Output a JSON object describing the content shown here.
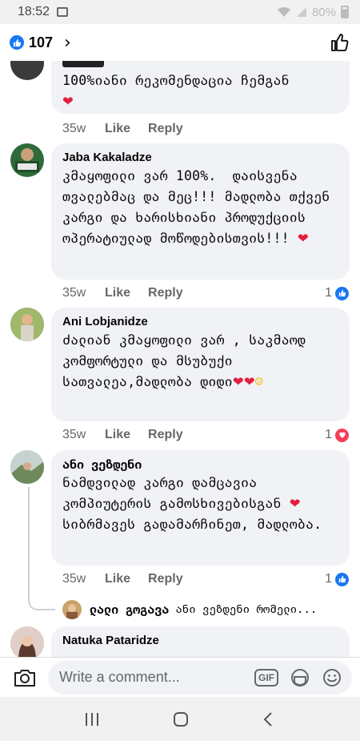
{
  "status_bar": {
    "time": "18:52",
    "battery": "80%"
  },
  "header": {
    "reaction_count": "107"
  },
  "comments": [
    {
      "name": "",
      "text": "100%იანი რეკომენდაცია ჩემგან",
      "time": "35w",
      "like_label": "Like",
      "reply_label": "Reply",
      "reaction_count": ""
    },
    {
      "name": "Jaba Kakaladze",
      "text": "კმაყოფილი ვარ 100%.  დაისვენა თვალებმაც და მეც!!! მადლობა თქვენ კარგი და ხარისხიანი პროდუქციის ოპერატიულად მოწოდებისთვის!!! ",
      "time": "35w",
      "like_label": "Like",
      "reply_label": "Reply",
      "reaction_count": "1"
    },
    {
      "name": "Ani Lobjanidze",
      "text": "ძალიან კმაყოფილი ვარ , საკმაოდ კომფორტული და მსუბუქი სათვალეა,მადლობა დიდი",
      "time": "35w",
      "like_label": "Like",
      "reply_label": "Reply",
      "reaction_count": "1"
    },
    {
      "name": "ანი ვეზდენი",
      "text_before_heart": "ნამდვილად კარგი დამცავია კომპიუტერის გამოსხივებისგან ",
      "text_after_heart": " სიბრმავეს გადამარჩინეთ, მადლობა.",
      "time": "35w",
      "like_label": "Like",
      "reply_label": "Reply",
      "reaction_count": "1"
    },
    {
      "name": "Natuka Pataridze"
    }
  ],
  "reply_preview": {
    "name": "ლალი გოგავა",
    "text": "ანი ვეზდენი რომელი..."
  },
  "composer": {
    "placeholder": "Write a comment...",
    "gif_label": "GIF"
  },
  "colors": {
    "facebook_blue": "#1877f2",
    "heart_red": "#e41e3f",
    "bubble_gray": "#f0f2f5",
    "meta_gray": "#65676b"
  },
  "icons": [
    "image-icon",
    "wifi-icon",
    "signal-icon",
    "battery-icon",
    "like-icon",
    "chevron-right-icon",
    "thumbs-up-outline-icon",
    "heart-icon",
    "smile-emoji-icon",
    "camera-icon",
    "gif-icon",
    "sticker-icon",
    "emoji-icon",
    "recents-icon",
    "home-icon",
    "back-icon"
  ]
}
